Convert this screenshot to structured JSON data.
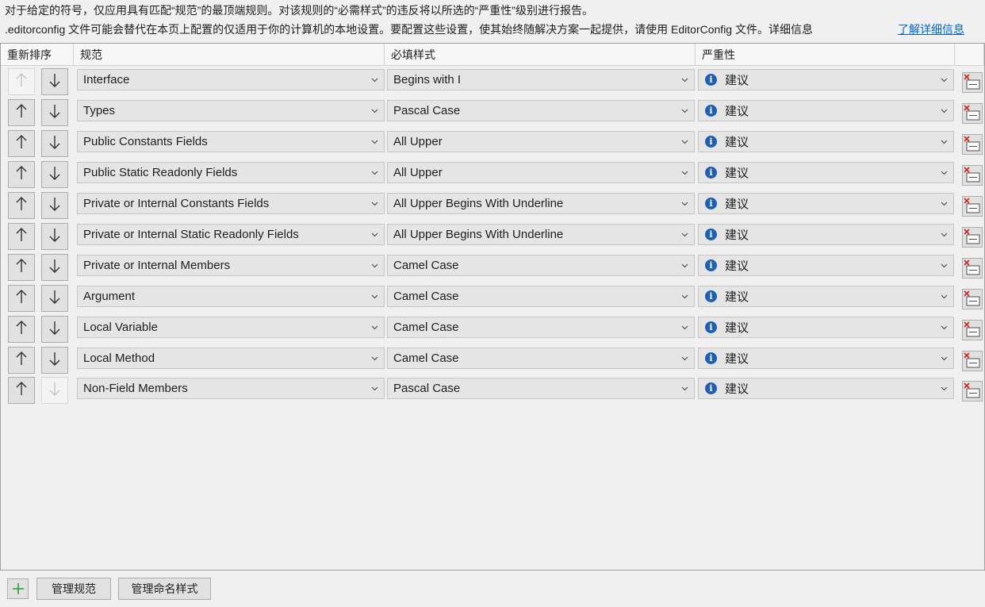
{
  "description": {
    "line1": "对于给定的符号，仅应用具有匹配“规范”的最顶端规则。对该规则的“必需样式”的违反将以所选的“严重性”级别进行报告。",
    "line2": ".editorconfig 文件可能会替代在本页上配置的仅适用于你的计算机的本地设置。要配置这些设置，使其始终随解决方案一起提供，请使用 EditorConfig 文件。详细信息",
    "learn_more": "了解详细信息"
  },
  "columns": {
    "reorder": "重新排序",
    "specification": "规范",
    "required_style": "必填样式",
    "severity": "严重性"
  },
  "rows": [
    {
      "spec": "Interface",
      "style": "Begins with I",
      "severity": "建议",
      "up_enabled": false,
      "down_enabled": true
    },
    {
      "spec": "Types",
      "style": "Pascal Case",
      "severity": "建议",
      "up_enabled": true,
      "down_enabled": true
    },
    {
      "spec": "Public Constants Fields",
      "style": "All Upper",
      "severity": "建议",
      "up_enabled": true,
      "down_enabled": true
    },
    {
      "spec": "Public Static Readonly Fields",
      "style": "All Upper",
      "severity": "建议",
      "up_enabled": true,
      "down_enabled": true
    },
    {
      "spec": "Private or Internal Constants Fields",
      "style": "All Upper Begins With Underline",
      "severity": "建议",
      "up_enabled": true,
      "down_enabled": true
    },
    {
      "spec": "Private or Internal Static Readonly Fields",
      "style": "All Upper Begins With Underline",
      "severity": "建议",
      "up_enabled": true,
      "down_enabled": true
    },
    {
      "spec": "Private or Internal Members",
      "style": "Camel Case",
      "severity": "建议",
      "up_enabled": true,
      "down_enabled": true
    },
    {
      "spec": "Argument",
      "style": "Camel Case",
      "severity": "建议",
      "up_enabled": true,
      "down_enabled": true
    },
    {
      "spec": "Local Variable",
      "style": "Camel Case",
      "severity": "建议",
      "up_enabled": true,
      "down_enabled": true
    },
    {
      "spec": "Local Method",
      "style": "Camel Case",
      "severity": "建议",
      "up_enabled": true,
      "down_enabled": true
    },
    {
      "spec": "Non-Field Members",
      "style": "Pascal Case",
      "severity": "建议",
      "up_enabled": true,
      "down_enabled": false
    }
  ],
  "buttons": {
    "manage_specifications": "管理规范",
    "manage_naming_styles": "管理命名样式"
  },
  "icons": {
    "severity": "info-icon",
    "delete": "delete-row-icon",
    "add": "plus-icon"
  },
  "colors": {
    "link": "#0066cc",
    "info": "#1e5fb4",
    "add_plus": "#2e9b3a",
    "delete_x": "#d42020"
  }
}
